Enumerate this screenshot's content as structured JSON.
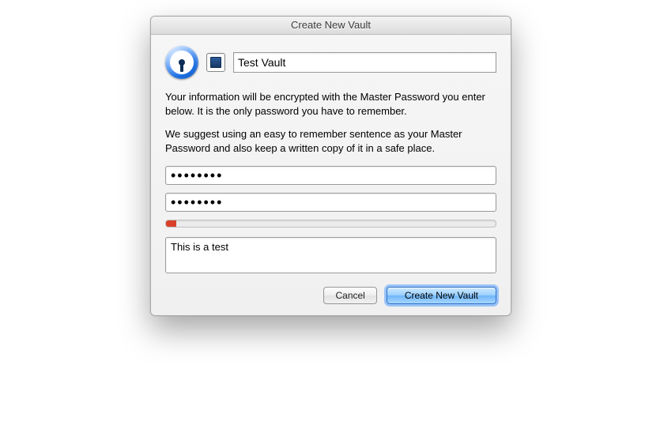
{
  "window": {
    "title": "Create New Vault"
  },
  "vault": {
    "name_value": "Test Vault",
    "swatch_color": "#2d5a9a"
  },
  "info": {
    "para1": "Your information will be encrypted with the Master Password you enter below. It is the only password you have to remember.",
    "para2": "We suggest using an easy to remember sentence as your Master Password and also keep a written copy of it in a safe place."
  },
  "password": {
    "value": "••••••••",
    "confirm_value": "••••••••",
    "strength_percent": 3
  },
  "hint": {
    "value": "This is a test"
  },
  "buttons": {
    "cancel": "Cancel",
    "create": "Create New Vault"
  }
}
